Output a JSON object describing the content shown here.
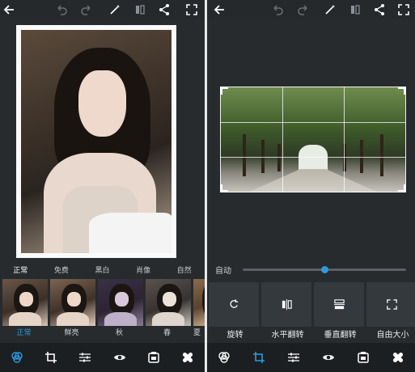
{
  "left": {
    "filter_tabs": [
      "正常",
      "免费",
      "黑白",
      "肖像",
      "自然"
    ],
    "active_filter_tab": 0,
    "thumbs": [
      {
        "label": "正常",
        "tint": "#d8c4b6",
        "active": true
      },
      {
        "label": "鲜亮",
        "tint": "#e4cbbc",
        "active": false
      },
      {
        "label": "秋",
        "tint": "#5c4d69",
        "active": false
      },
      {
        "label": "春",
        "tint": "#c8c0b8",
        "active": false
      },
      {
        "label": "夏",
        "tint": "#b89a7a",
        "active": false
      }
    ]
  },
  "right": {
    "auto_label": "自动",
    "slider_value": 0.5,
    "tools": [
      {
        "icon": "rotate-icon",
        "label": "旋转"
      },
      {
        "icon": "flip-horizontal-icon",
        "label": "水平翻转"
      },
      {
        "icon": "flip-vertical-icon",
        "label": "垂直翻转"
      },
      {
        "icon": "free-size-icon",
        "label": "自由大小"
      }
    ]
  },
  "toolbar_icons": [
    "back-icon",
    "undo-icon",
    "redo-icon",
    "magic-wand-icon",
    "compare-icon",
    "share-icon",
    "fullscreen-icon"
  ],
  "bottom_icons": [
    "filters-icon",
    "crop-icon",
    "adjust-icon",
    "eye-icon",
    "sticker-icon",
    "healing-icon"
  ],
  "colors": {
    "accent": "#2b9be0",
    "bg": "#272b2e",
    "toolbar": "#1c1f22"
  }
}
